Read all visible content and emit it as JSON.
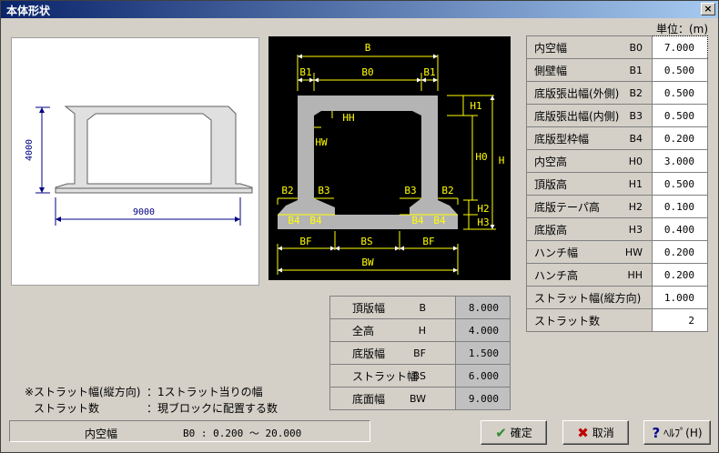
{
  "window": {
    "title": "本体形状",
    "close_glyph": "×"
  },
  "unit": "単位：(m)",
  "preview": {
    "height_label": "4000",
    "width_label": "9000"
  },
  "diagram": {
    "labels": {
      "B": "B",
      "B1_left": "B1",
      "B0": "B0",
      "B1_right": "B1",
      "H1": "H1",
      "HH": "HH",
      "HW": "HW",
      "H0": "H0",
      "H": "H",
      "B2_left": "B2",
      "B3_left": "B3",
      "B3_right": "B3",
      "B2_right": "B2",
      "H2": "H2",
      "H3": "H3",
      "B4_1": "B4",
      "B4_2": "B4",
      "B4_3": "B4",
      "B4_4": "B4",
      "BF_left": "BF",
      "BS": "BS",
      "BF_right": "BF",
      "BW": "BW"
    }
  },
  "params": [
    {
      "label": "内空幅",
      "sym": "B0",
      "value": "7.000"
    },
    {
      "label": "側壁幅",
      "sym": "B1",
      "value": "0.500"
    },
    {
      "label": "底版張出幅(外側)",
      "sym": "B2",
      "value": "0.500"
    },
    {
      "label": "底版張出幅(内側)",
      "sym": "B3",
      "value": "0.500"
    },
    {
      "label": "底版型枠幅",
      "sym": "B4",
      "value": "0.200"
    },
    {
      "label": "内空高",
      "sym": "H0",
      "value": "3.000"
    },
    {
      "label": "頂版高",
      "sym": "H1",
      "value": "0.500"
    },
    {
      "label": "底版テーパ高",
      "sym": "H2",
      "value": "0.100"
    },
    {
      "label": "底版高",
      "sym": "H3",
      "value": "0.400"
    },
    {
      "label": "ハンチ幅",
      "sym": "HW",
      "value": "0.200"
    },
    {
      "label": "ハンチ高",
      "sym": "HH",
      "value": "0.200"
    },
    {
      "label": "ストラット幅(縦方向)",
      "sym": "",
      "value": "1.000"
    },
    {
      "label": "ストラット数",
      "sym": "",
      "value": "2"
    }
  ],
  "results": [
    {
      "label": "頂版幅",
      "sym": "B",
      "value": "8.000"
    },
    {
      "label": "全高",
      "sym": "H",
      "value": "4.000"
    },
    {
      "label": "底版幅",
      "sym": "BF",
      "value": "1.500"
    },
    {
      "label": "ストラット幅",
      "sym": "BS",
      "value": "6.000"
    },
    {
      "label": "底面幅",
      "sym": "BW",
      "value": "9.000"
    }
  ],
  "notes": [
    {
      "k": "※ストラット幅(縦方向)",
      "v": "：1ストラット当りの幅"
    },
    {
      "k": "ストラット数",
      "v": "：現ブロックに配置する数"
    }
  ],
  "status": {
    "field": "内空幅",
    "range": "B0 : 0.200 ～ 20.000"
  },
  "buttons": {
    "ok": {
      "label": "確定",
      "glyph": "✔"
    },
    "cancel": {
      "label": "取消",
      "glyph": "✖"
    },
    "help": {
      "label": "ﾍﾙﾌﾟ(H)",
      "glyph": "?"
    }
  }
}
